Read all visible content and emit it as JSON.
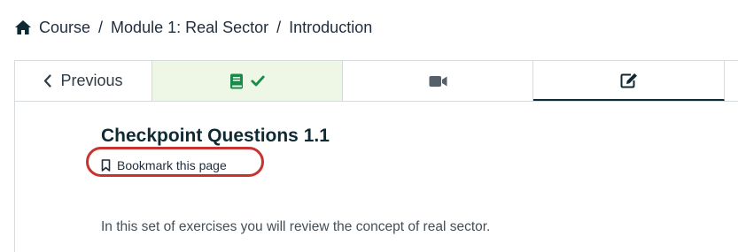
{
  "breadcrumb": {
    "icon": "home-icon",
    "items": [
      "Course",
      "Module 1: Real Sector",
      "Introduction"
    ],
    "separator": "/"
  },
  "unit_nav": {
    "previous_label": "Previous",
    "previous_icon": "chevron-left-icon",
    "tabs": [
      {
        "icon": "book-icon",
        "status_icon": "check-icon",
        "state": "completed"
      },
      {
        "icon": "video-camera-icon",
        "state": "default"
      },
      {
        "icon": "edit-icon",
        "state": "active"
      }
    ],
    "colors": {
      "completed_bg": "#eef6e6",
      "completed_icon": "#1a8a4a",
      "active_underline": "#0c2b33",
      "icon_default": "#55606b"
    }
  },
  "main": {
    "title": "Checkpoint Questions 1.1",
    "bookmark_label": "Bookmark this page",
    "bookmark_icon": "bookmark-icon",
    "highlight_color": "#c8322f",
    "intro": "In this set of exercises you will review the concept of real sector."
  }
}
